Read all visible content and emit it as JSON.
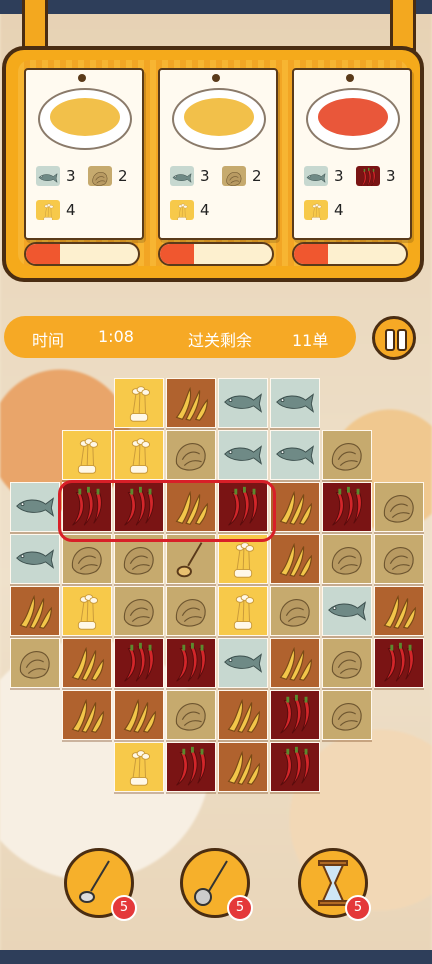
{
  "orders": [
    {
      "dish": "pickled-fish-soup-icon",
      "requirements": [
        {
          "icon": "fish-icon",
          "count": "3"
        },
        {
          "icon": "cabbage-icon",
          "count": "2"
        },
        {
          "icon": "enoki-mushroom-icon",
          "count": "4"
        }
      ],
      "progress": 0.3
    },
    {
      "dish": "pickled-fish-soup-icon",
      "requirements": [
        {
          "icon": "fish-icon",
          "count": "3"
        },
        {
          "icon": "cabbage-icon",
          "count": "2"
        },
        {
          "icon": "enoki-mushroom-icon",
          "count": "4"
        }
      ],
      "progress": 0.3
    },
    {
      "dish": "boiled-fish-chili-icon",
      "requirements": [
        {
          "icon": "fish-icon",
          "count": "3"
        },
        {
          "icon": "chili-pepper-icon",
          "count": "3"
        },
        {
          "icon": "enoki-mushroom-icon",
          "count": "4"
        }
      ],
      "progress": 0.3
    }
  ],
  "status": {
    "time_label": "时间",
    "time_value": "1:08",
    "remaining_label": "过关剩余",
    "remaining_value": "11单"
  },
  "colors": {
    "enoki": "#f7c94a",
    "bamboo": "#b0622e",
    "fish": "#c7d8d0",
    "cabbage": "#c6aa6e",
    "chili": "#7a1414",
    "orange": "#f6a925",
    "highlight": "#d81f28"
  },
  "grid": {
    "rows": [
      [
        "",
        "",
        "enoki",
        "bamboo",
        "fish",
        "fish",
        "",
        ""
      ],
      [
        "",
        "enoki",
        "enoki",
        "cabbage",
        "fish",
        "fish",
        "cabbage",
        ""
      ],
      [
        "fish",
        "chili",
        "chili",
        "bamboo",
        "chili",
        "bamboo",
        "chili",
        "cabbage"
      ],
      [
        "fish",
        "cabbage",
        "cabbage",
        "ladle",
        "enoki",
        "bamboo",
        "cabbage",
        "cabbage"
      ],
      [
        "bamboo",
        "enoki",
        "cabbage",
        "cabbage",
        "enoki",
        "cabbage",
        "fish",
        "bamboo"
      ],
      [
        "cabbage",
        "bamboo",
        "chili",
        "chili",
        "fish",
        "bamboo",
        "cabbage",
        "chili"
      ],
      [
        "",
        "bamboo",
        "bamboo",
        "cabbage",
        "bamboo",
        "chili",
        "cabbage",
        ""
      ],
      [
        "",
        "",
        "enoki",
        "chili",
        "bamboo",
        "chili",
        "",
        ""
      ]
    ]
  },
  "tools": [
    {
      "icon": "spoon-icon",
      "count": "5"
    },
    {
      "icon": "ladle-icon",
      "count": "5"
    },
    {
      "icon": "hourglass-icon",
      "count": "5"
    }
  ]
}
